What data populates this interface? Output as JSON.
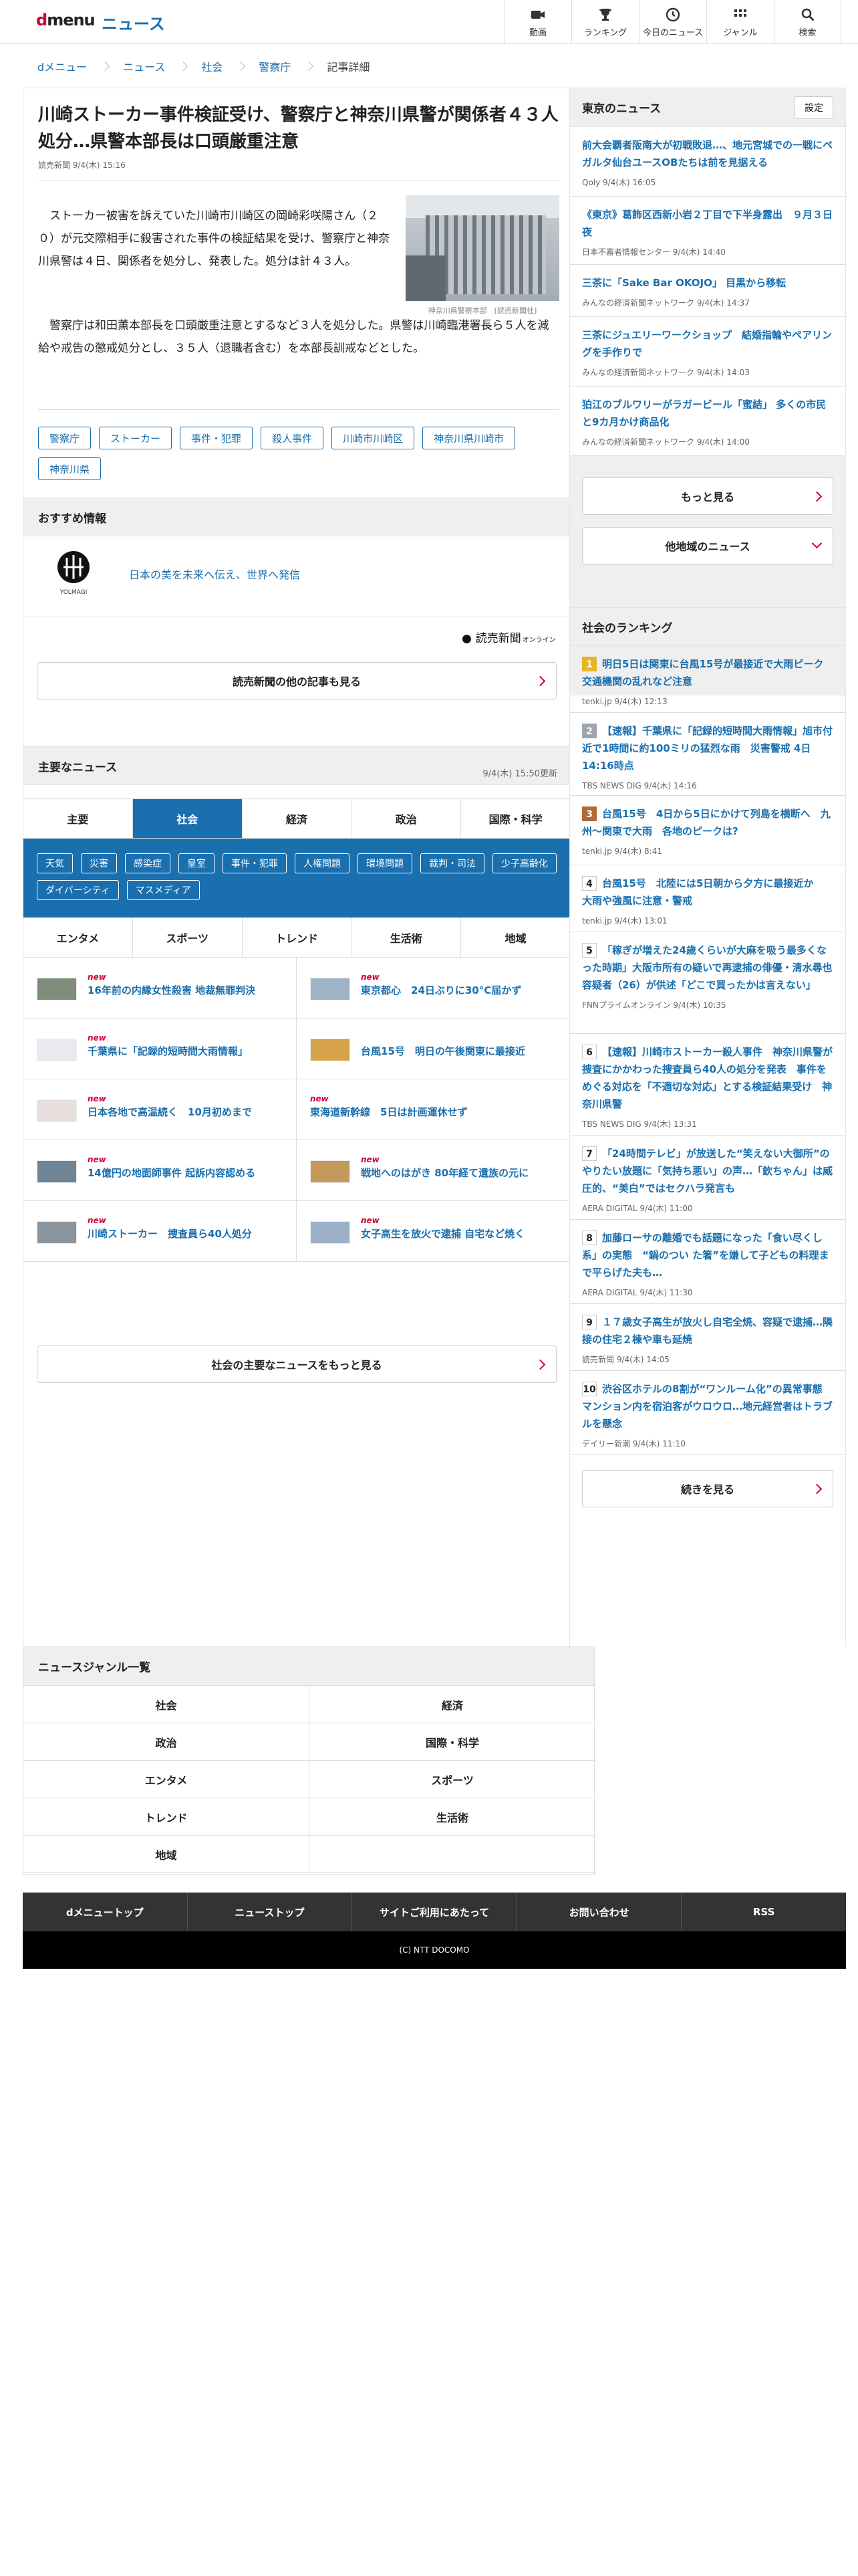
{
  "header": {
    "logo_d": "d",
    "logo_menu": "menu",
    "service": "ニュース",
    "nav": [
      {
        "icon": "video-icon",
        "label": "動画"
      },
      {
        "icon": "trophy-icon",
        "label": "ランキング"
      },
      {
        "icon": "clock-icon",
        "label": "今日のニュース"
      },
      {
        "icon": "grid-icon",
        "label": "ジャンル"
      },
      {
        "icon": "search-icon",
        "label": "検索"
      }
    ]
  },
  "breadcrumb": [
    "dメニュー",
    "ニュース",
    "社会",
    "警察庁",
    "記事詳細"
  ],
  "article": {
    "title": "川崎ストーカー事件検証受け、警察庁と神奈川県警が関係者４３人処分…県警本部長は口頭厳重注意",
    "source": "読売新聞",
    "date": "9/4(木) 15:16",
    "p1": "ストーカー被害を訴えていた川崎市川崎区の岡崎彩咲陽さん（２０）が元交際相手に殺害された事件の検証結果を受け、警察庁と神奈川県警は４日、関係者を処分し、発表した。処分は計４３人。",
    "p2": "警察庁は和田薫本部長を口頭厳重注意とするなど３人を処分した。県警は川崎臨港署長ら５人を減給や戒告の懲戒処分とし、３５人（退職者含む）を本部長訓戒などとした。",
    "image_caption": "神奈川県警察本部　[読売新聞社]",
    "tags": [
      "警察庁",
      "ストーカー",
      "事件・犯罪",
      "殺人事件",
      "川崎市川崎区",
      "神奈川県川崎市",
      "神奈川県"
    ]
  },
  "recommend": {
    "heading": "おすすめ情報",
    "logo_text": "YOLMAGI",
    "text": "日本の美を未来へ伝え、世界へ発信",
    "publisher_logo": "読売新聞",
    "publisher_logo_sub": "オンライン",
    "more_label": "読売新聞の他の記事も見る"
  },
  "major": {
    "heading": "主要なニュース",
    "updated": "9/4(木) 15:50更新",
    "tabs": [
      "主要",
      "社会",
      "経済",
      "政治",
      "国際・科学"
    ],
    "active_tab": "社会",
    "subcats": [
      "天気",
      "災害",
      "感染症",
      "皇室",
      "事件・犯罪",
      "人権問題",
      "環境問題",
      "裁判・司法",
      "少子高齢化",
      "ダイバーシティ",
      "マスメディア"
    ],
    "tabs2": [
      "エンタメ",
      "スポーツ",
      "トレンド",
      "生活術",
      "地域"
    ],
    "items": [
      {
        "new": "new",
        "title": "16年前の内縁女性殺害 地裁無罪判決",
        "img": true
      },
      {
        "new": "new",
        "title": "東京都心　24日ぶりに30°C届かず",
        "img": true
      },
      {
        "new": "new",
        "title": "千葉県に「記録的短時間大雨情報」",
        "img": true
      },
      {
        "new": "",
        "title": "台風15号　明日の午後関東に最接近",
        "img": true
      },
      {
        "new": "new",
        "title": "日本各地で高温続く　10月初めまで",
        "img": true
      },
      {
        "new": "new",
        "title": "東海道新幹線　5日は計画運休せず",
        "img": false
      },
      {
        "new": "new",
        "title": "14億円の地面師事件 起訴内容認める",
        "img": true
      },
      {
        "new": "new",
        "title": "戦地へのはがき 80年経て遺族の元に",
        "img": true
      },
      {
        "new": "new",
        "title": "川崎ストーカー　捜査員ら40人処分",
        "img": true
      },
      {
        "new": "new",
        "title": "女子高生を放火で逮捕 自宅など焼く",
        "img": true
      }
    ],
    "more_label": "社会の主要なニュースをもっと見る"
  },
  "tokyo": {
    "heading": "東京のニュース",
    "settings": "設定",
    "items": [
      {
        "title": "前大会覇者阪南大が初戦敗退…、地元宮城での一戦にベガルタ仙台ユースOBたちは前を見据える",
        "meta": "Qoly 9/4(木) 16:05"
      },
      {
        "title": "《東京》葛飾区西新小岩２丁目で下半身露出　９月３日夜",
        "meta": "日本不審者情報センター 9/4(木) 14:40"
      },
      {
        "title": "三茶に「Sake Bar OKOJO」 目黒から移転",
        "meta": "みんなの経済新聞ネットワーク 9/4(木) 14:37"
      },
      {
        "title": "三茶にジュエリーワークショップ　結婚指輪やペアリングを手作りで",
        "meta": "みんなの経済新聞ネットワーク 9/4(木) 14:03"
      },
      {
        "title": "狛江のブルワリーがラガービール「蜜結」 多くの市民と9カ月かけ商品化",
        "meta": "みんなの経済新聞ネットワーク 9/4(木) 14:00"
      }
    ],
    "more_label": "もっと見る",
    "other_label": "他地域のニュース"
  },
  "ranking": {
    "heading": "社会のランキング",
    "items": [
      {
        "n": "1",
        "title": "明日5日は関東に台風15号が最接近で大雨ピーク　交通機関の乱れなど注意",
        "meta": "tenki.jp 9/4(木) 12:13"
      },
      {
        "n": "2",
        "title": "【速報】千葉県に「記録的短時間大雨情報」旭市付近で1時間に約100ミリの猛烈な雨　災害警戒 4日14:16時点",
        "meta": "TBS NEWS DIG 9/4(木) 14:16"
      },
      {
        "n": "3",
        "title": "台風15号　4日から5日にかけて列島を横断へ　九州〜関東で大雨　各地のピークは?",
        "meta": "tenki.jp 9/4(木) 8:41"
      },
      {
        "n": "4",
        "title": "台風15号　北陸には5日朝から夕方に最接近か　大雨や強風に注意・警戒",
        "meta": "tenki.jp 9/4(木) 13:01"
      },
      {
        "n": "5",
        "title": "「稼ぎが増えた24歳くらいが大麻を吸う最多くなった時期」大阪市所有の疑いで再逮捕の俳優・清水尋也容疑者（26）が供述「どこで買ったかは言えない」",
        "meta": "FNNプライムオンライン 9/4(木) 10:35"
      },
      {
        "n": "6",
        "title": "【速報】川崎市ストーカー殺人事件　神奈川県警が捜査にかかわった捜査員ら40人の処分を発表　事件をめぐる対応を「不適切な対応」とする検証結果受け　神奈川県警",
        "meta": "TBS NEWS DIG 9/4(木) 13:31"
      },
      {
        "n": "7",
        "title": "「24時間テレビ」が放送した“笑えない大御所”のやりたい放題に「気持ち悪い」の声…「欽ちゃん」は威圧的、“美白”ではセクハラ発言も",
        "meta": "AERA DIGITAL 9/4(木) 11:00"
      },
      {
        "n": "8",
        "title": "加藤ローサの離婚でも話題になった「食い尽くし系」の実態　“鍋のつい た箸”を嫌して子どもの料理まで平らげた夫も…",
        "meta": "AERA DIGITAL 9/4(木) 11:30"
      },
      {
        "n": "9",
        "title": "１７歳女子高生が放火し自宅全焼、容疑で逮捕…隣接の住宅２棟や車も延焼",
        "meta": "読売新聞 9/4(木) 14:05"
      },
      {
        "n": "10",
        "title": "渋谷区ホテルの8割が“ワンルーム化”の異常事態　マンション内を宿泊客がウロウロ…地元経営者はトラブルを懸念",
        "meta": "デイリー新潮 9/4(木) 11:10"
      }
    ],
    "more_label": "続きを見る"
  },
  "genre": {
    "heading": "ニュースジャンル一覧",
    "items": [
      "社会",
      "経済",
      "政治",
      "国際・科学",
      "エンタメ",
      "スポーツ",
      "トレンド",
      "生活術",
      "地域"
    ]
  },
  "footer": {
    "links": [
      "dメニュートップ",
      "ニューストップ",
      "サイトご利用にあたって",
      "お問い合わせ",
      "RSS"
    ],
    "copyright": "(C) NTT DOCOMO"
  }
}
